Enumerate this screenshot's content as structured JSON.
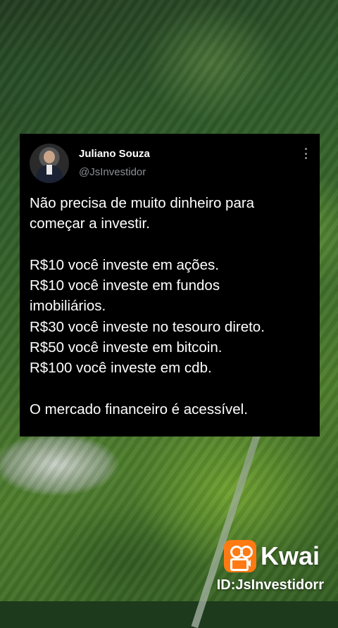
{
  "tweet": {
    "author_name": "Juliano Souza",
    "author_handle": "@JsInvestidor",
    "text": "Não precisa de muito dinheiro para\ncomeçar a investir.\n\nR$10 você investe em ações.\nR$10 você investe em fundos\nimobiliários.\nR$30 você investe no tesouro direto.\nR$50 você investe em bitcoin.\nR$100 você investe em cdb.\n\nO mercado financeiro é acessível."
  },
  "watermark": {
    "brand": "Kwai",
    "id_label": "ID:JsInvestidorr",
    "brand_color": "#ff7a12"
  },
  "icons": {
    "more": "more-options-icon",
    "logo": "kwai-logo-icon"
  }
}
